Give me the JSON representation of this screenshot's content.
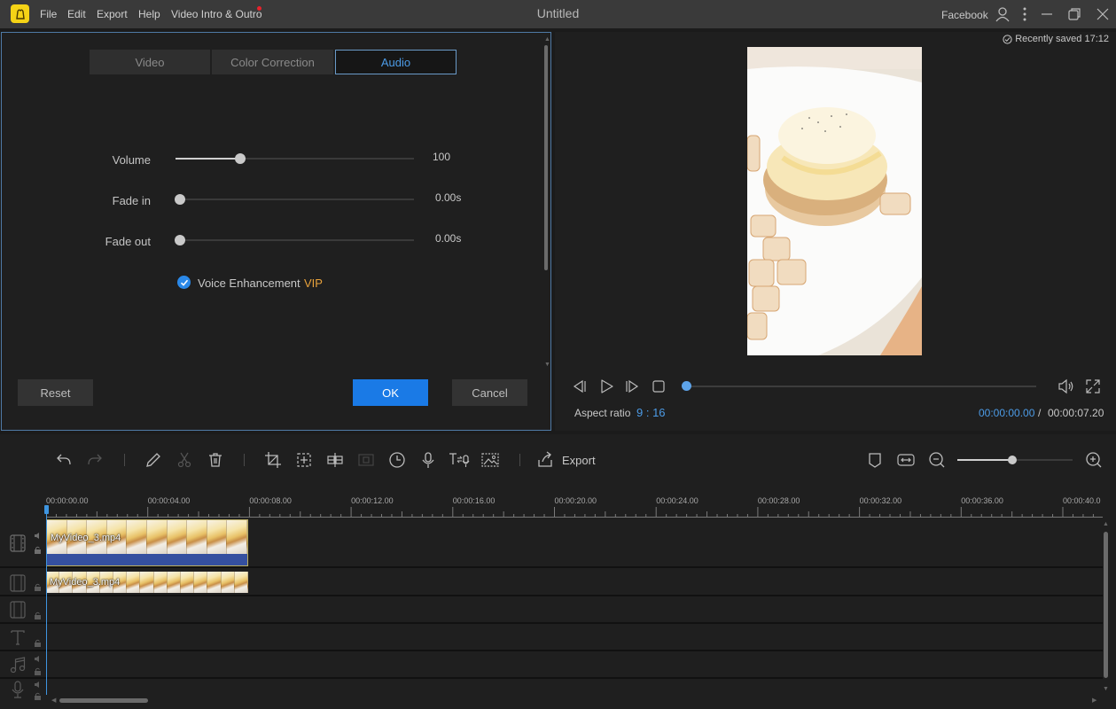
{
  "app": {
    "title": "Untitled",
    "menu": [
      "File",
      "Edit",
      "Export",
      "Help",
      "Video Intro & Outro"
    ],
    "account_label": "Facebook",
    "colors": {
      "accent": "#1a7ae6",
      "accent_text": "#4c9be6",
      "vip": "#e9a23b",
      "logo": "#f5d316",
      "notification_dot": "#e8222c"
    }
  },
  "properties": {
    "tabs": [
      {
        "label": "Video",
        "active": false
      },
      {
        "label": "Color Correction",
        "active": false
      },
      {
        "label": "Audio",
        "active": true
      }
    ],
    "volume": {
      "label": "Volume",
      "value": "100",
      "slider_fraction": 0.27
    },
    "fade_in": {
      "label": "Fade in",
      "value": "0.00s",
      "slider_fraction": 0.0
    },
    "fade_out": {
      "label": "Fade out",
      "value": "0.00s",
      "slider_fraction": 0.0
    },
    "voice_enhancement": {
      "label": "Voice Enhancement",
      "checked": true,
      "badge": "VIP"
    },
    "buttons": {
      "reset": "Reset",
      "ok": "OK",
      "cancel": "Cancel"
    }
  },
  "preview": {
    "saved_status": "Recently saved 17:12",
    "aspect_label": "Aspect ratio",
    "aspect_value": "9 : 16",
    "time_current": "00:00:00.00",
    "time_separator": "/",
    "time_total": "00:00:07.20",
    "playback_fraction": 0.0
  },
  "toolbar": {
    "export_label": "Export",
    "zoom_fraction": 0.48,
    "icons": [
      "undo-icon",
      "redo-icon",
      "edit-icon",
      "cut-icon",
      "delete-icon",
      "crop-icon",
      "add-frame-icon",
      "split-icon",
      "mosaic-icon",
      "speed-icon",
      "record-voice-icon",
      "text-to-speech-icon",
      "picture-icon",
      "export-icon",
      "marker-icon",
      "fit-icon",
      "zoom-out-icon",
      "zoom-in-icon"
    ]
  },
  "timeline": {
    "ruler": [
      "00:00:00.00",
      "00:00:04.00",
      "00:00:08.00",
      "00:00:12.00",
      "00:00:16.00",
      "00:00:20.00",
      "00:00:24.00",
      "00:00:28.00",
      "00:00:32.00",
      "00:00:36.00",
      "00:00:40.0"
    ],
    "tracks": [
      {
        "type": "video",
        "icon": "film-icon",
        "clip": "MyVideo_3.mp4",
        "selected": true
      },
      {
        "type": "video",
        "icon": "film-icon",
        "clip": "MyVideo_3.mp4",
        "selected": false
      },
      {
        "type": "video",
        "icon": "film-icon",
        "clip": null
      },
      {
        "type": "text",
        "icon": "text-track-icon",
        "clip": null
      },
      {
        "type": "music",
        "icon": "music-icon",
        "clip": null
      },
      {
        "type": "voice",
        "icon": "microphone-icon",
        "clip": null
      }
    ]
  }
}
